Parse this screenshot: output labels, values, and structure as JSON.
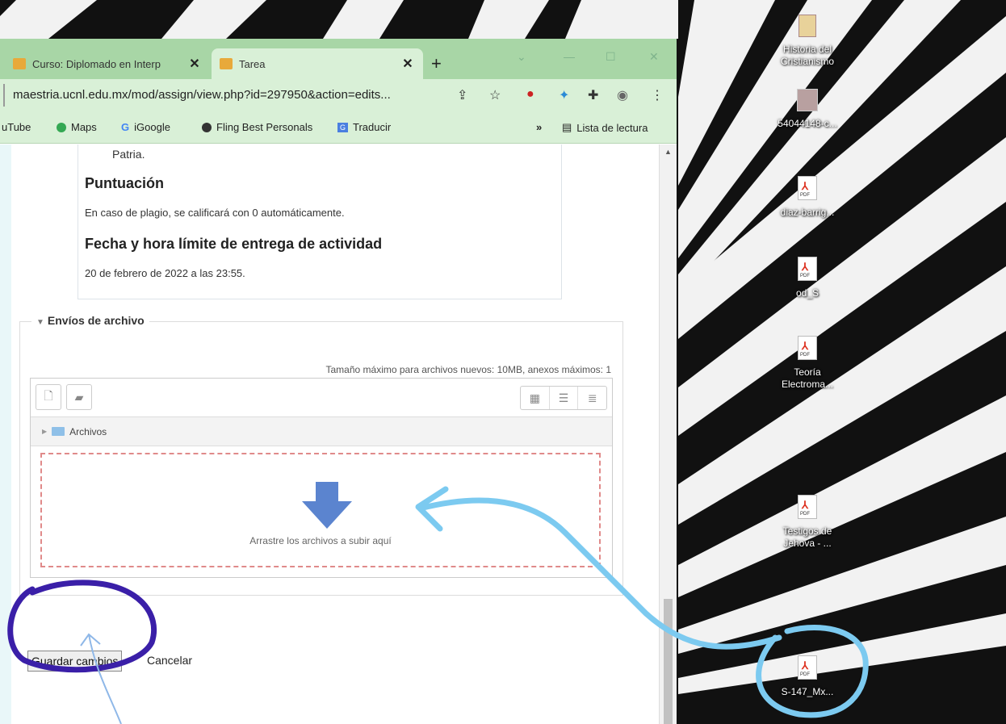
{
  "browser": {
    "tabs": [
      {
        "label": "Curso: Diplomado en Interp",
        "close": "✕"
      },
      {
        "label": "Tarea",
        "close": "✕"
      }
    ],
    "new_tab": "+",
    "url": "maestria.ucnl.edu.mx/mod/assign/view.php?id=297950&action=edits...",
    "bookmarks": [
      {
        "label": "uTube"
      },
      {
        "label": "Maps"
      },
      {
        "label": "iGoogle"
      },
      {
        "label": "Fling Best Personals"
      },
      {
        "label": "Traducir"
      }
    ],
    "bookmarks_more": "»",
    "reading_list": "Lista de lectura"
  },
  "page": {
    "patria": "Patria.",
    "score_heading": "Puntuación",
    "score_text": "En caso de plagio, se calificará con 0 automáticamente.",
    "deadline_heading": "Fecha y hora límite de entrega de actividad",
    "deadline_text": "20 de febrero de 2022 a las 23:55.",
    "fieldset_legend": "Envíos de archivo",
    "max_size": "Tamaño máximo para archivos nuevos: 10MB, anexos máximos: 1",
    "path_label": "Archivos",
    "dropzone_text": "Arrastre los archivos a subir aquí",
    "save_label": "Guardar cambios",
    "cancel_label": "Cancelar"
  },
  "desktop": {
    "icons": [
      {
        "label": "Historia del Cristianismo",
        "kind": "book-icon"
      },
      {
        "label": "54044148-c...",
        "kind": "image-icon"
      },
      {
        "label": "diaz-barrig...",
        "kind": "pdf-icon"
      },
      {
        "label": "od_S",
        "kind": "pdf-icon"
      },
      {
        "label": "Teoría Electroma...",
        "kind": "pdf-icon"
      },
      {
        "label": "Testigos de Jehova - ...",
        "kind": "pdf-icon"
      },
      {
        "label": "S-147_Mx...",
        "kind": "pdf-icon"
      }
    ]
  },
  "colors": {
    "tabstrip": "#a8d6a6",
    "toolbar": "#d9f0d7",
    "dropzone_border": "#e08a8a",
    "arrow_blue": "#5b84cf",
    "annotation_purple": "#3a1fa8",
    "annotation_cyan": "#7ccaf0"
  }
}
